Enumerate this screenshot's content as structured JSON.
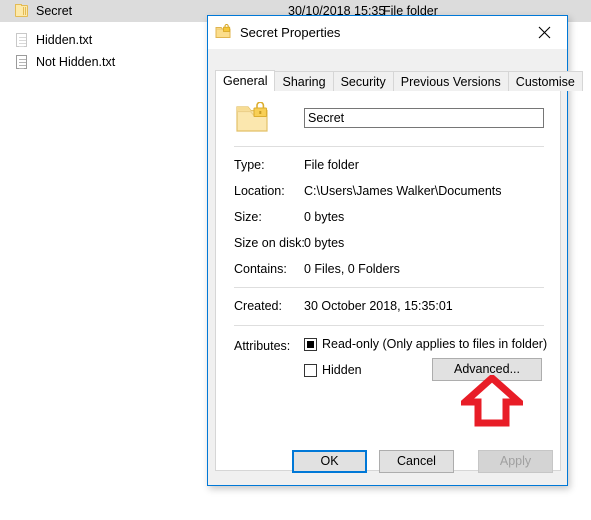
{
  "explorer": {
    "files": [
      {
        "name": "Secret",
        "icon": "folder-icon",
        "selected": true,
        "date": "30/10/2018 15:35",
        "type": "File folder"
      },
      {
        "name": "Hidden.txt",
        "icon": "document-icon-dim",
        "selected": false,
        "date": "",
        "type": ""
      },
      {
        "name": "Not Hidden.txt",
        "icon": "document-icon",
        "selected": false,
        "date": "",
        "type": ""
      }
    ]
  },
  "dialog": {
    "title": "Secret Properties",
    "title_icon": "folder-locked-icon",
    "close_label": "✕",
    "tabs": [
      {
        "label": "General",
        "active": true
      },
      {
        "label": "Sharing",
        "active": false
      },
      {
        "label": "Security",
        "active": false
      },
      {
        "label": "Previous Versions",
        "active": false
      },
      {
        "label": "Customise",
        "active": false
      }
    ],
    "general": {
      "folder_icon": "folder-locked-icon",
      "name_value": "Secret",
      "properties": [
        {
          "label": "Type:",
          "value": "File folder"
        },
        {
          "label": "Location:",
          "value": "C:\\Users\\James Walker\\Documents"
        },
        {
          "label": "Size:",
          "value": "0 bytes"
        },
        {
          "label": "Size on disk:",
          "value": "0 bytes"
        },
        {
          "label": "Contains:",
          "value": "0 Files, 0 Folders"
        }
      ],
      "created": {
        "label": "Created:",
        "value": "30 October 2018, 15:35:01"
      },
      "attributes": {
        "label": "Attributes:",
        "readonly_label": "Read-only (Only applies to files in folder)",
        "readonly_state": "indeterminate",
        "hidden_label": "Hidden",
        "hidden_state": "unchecked",
        "advanced_label": "Advanced..."
      }
    },
    "footer": {
      "ok_label": "OK",
      "cancel_label": "Cancel",
      "apply_label": "Apply"
    }
  },
  "annotation": {
    "arrow": "up-arrow-annotation",
    "color": "#e81d27"
  },
  "colors": {
    "accent": "#0078d7",
    "selection": "#dcdcdc",
    "dialog_bg": "#f0f0f0",
    "folder": "#fde9a9"
  }
}
